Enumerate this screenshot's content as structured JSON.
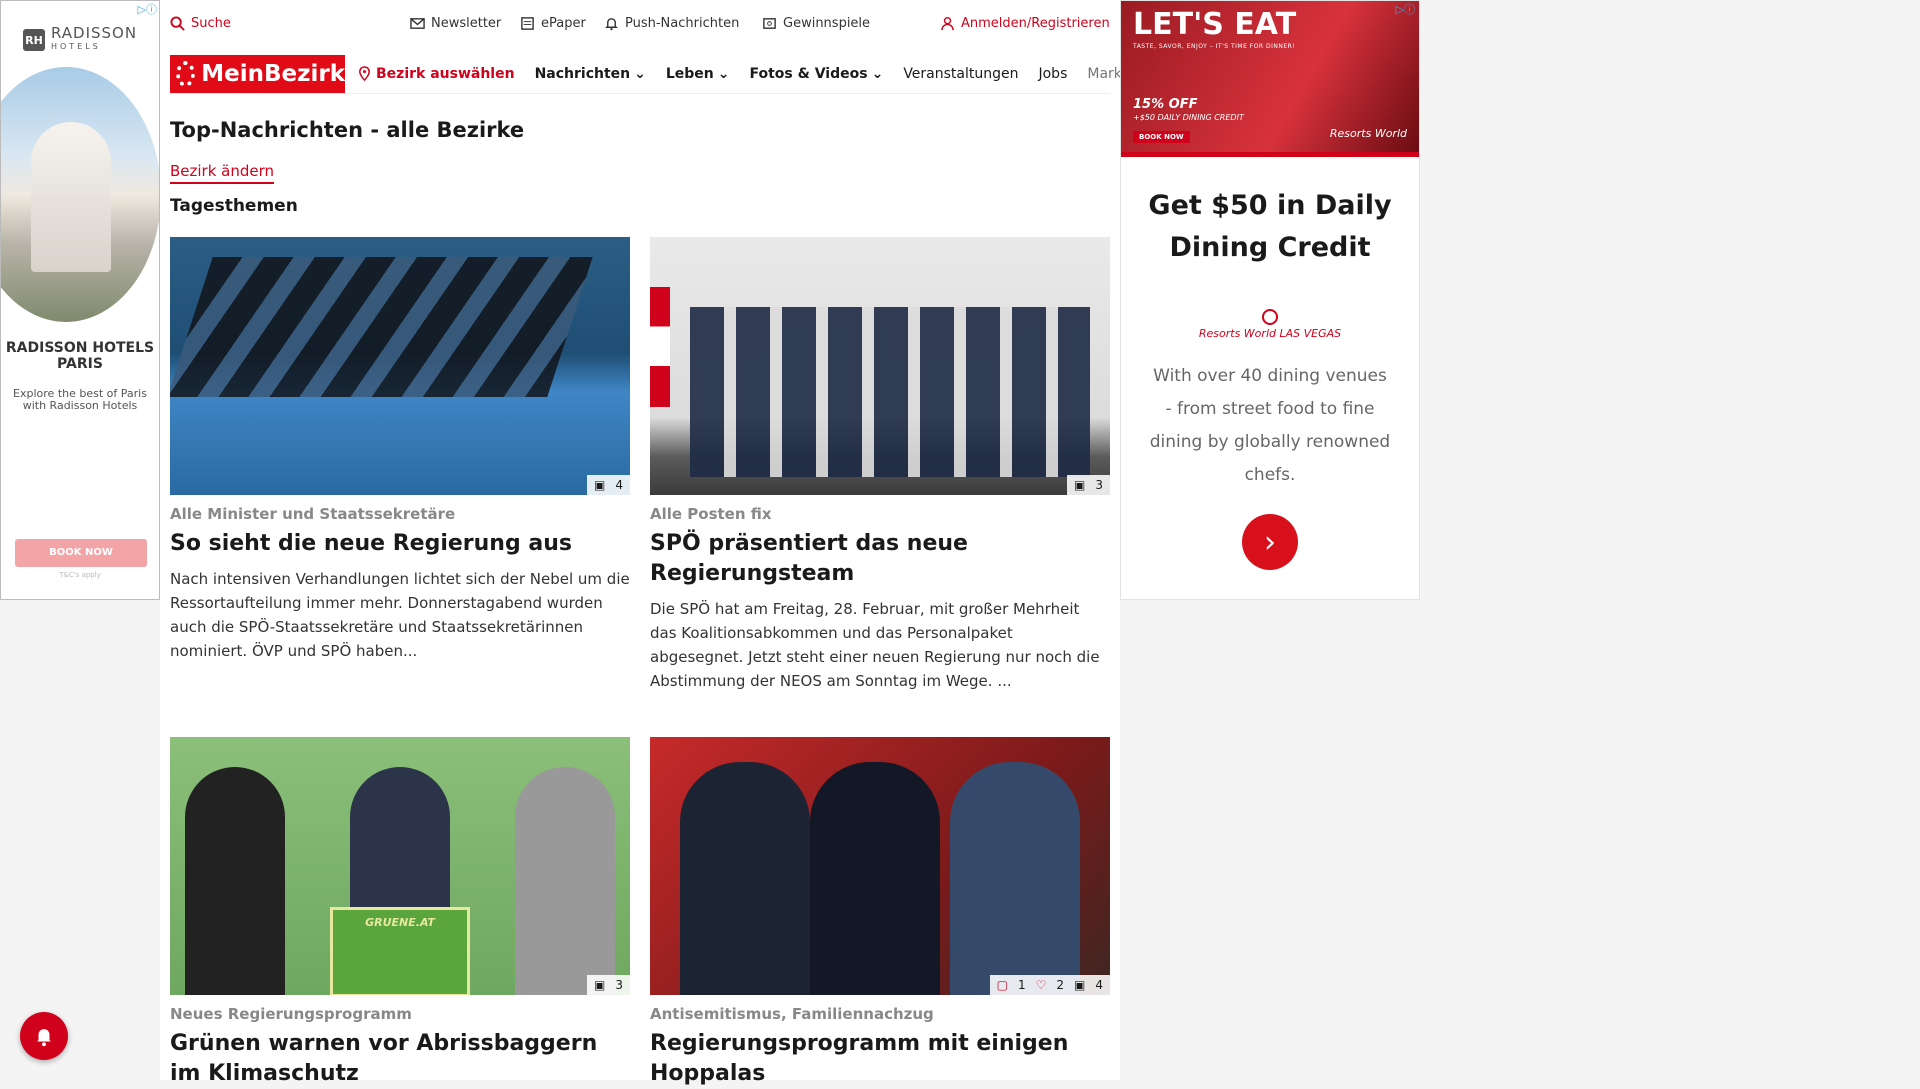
{
  "ad_left": {
    "adchoice": "▷ⓘ",
    "brand_mono": "RH",
    "brand_name": "RADISSON",
    "brand_sub": "HOTELS",
    "title": "RADISSON HOTELS PARIS",
    "description": "Explore the best of Paris with Radisson Hotels",
    "cta": "BOOK NOW",
    "tcs": "T&C's apply"
  },
  "topbar": {
    "search": "Suche",
    "newsletter": "Newsletter",
    "epaper": "ePaper",
    "push": "Push-Nachrichten",
    "gewinnspiele": "Gewinnspiele",
    "login": "Anmelden/Registrieren"
  },
  "nav": {
    "logo": "MeinBezirk",
    "bezirk": "Bezirk auswählen",
    "items": [
      "Nachrichten",
      "Leben",
      "Fotos & Videos",
      "Veranstaltungen",
      "Jobs",
      "Marktplatz"
    ]
  },
  "page": {
    "title": "Top-Nachrichten - alle Bezirke",
    "change_link": "Bezirk ändern",
    "section": "Tagesthemen"
  },
  "articles": [
    {
      "kicker": "Alle Minister und Staatssekretäre",
      "title": "So sieht die neue Regierung aus",
      "teaser": "Nach intensiven Verhandlungen lichtet sich der Nebel um die Ressortaufteilung immer mehr. Donnerstagabend wurden auch die SPÖ-Staatssekretäre und Staatssekretärinnen nominiert. ÖVP und SPÖ haben...",
      "photos": "4"
    },
    {
      "kicker": "Alle Posten fix",
      "title": "SPÖ präsentiert das neue Regierungsteam",
      "teaser": "Die SPÖ hat am Freitag, 28. Februar, mit großer Mehrheit das Koalitionsabkommen und das Personalpaket abgesegnet. Jetzt steht einer neuen Regierung nur noch die Abstimmung der NEOS am Sonntag im Wege. ...",
      "photos": "3"
    },
    {
      "kicker": "Neues Regierungsprogramm",
      "title": "Grünen warnen vor Abrissbaggern im Klimaschutz",
      "photos": "3",
      "podium_text": "GRUENE.AT"
    },
    {
      "kicker": "Antisemitismus, Familiennachzug",
      "title": "Regierungsprogramm mit einigen Hoppalas",
      "comments": "1",
      "likes": "2",
      "photos": "4"
    }
  ],
  "ad_right": {
    "adchoice": "▷ⓘ",
    "banner_headline": "LET'S EAT",
    "banner_tagline": "TASTE, SAVOR, ENJOY – IT'S TIME FOR DINNER!",
    "banner_offer": "15% OFF",
    "banner_sub": "+$50 DAILY DINING CREDIT",
    "banner_cta": "BOOK NOW",
    "banner_brand": "Resorts World",
    "headline": "Get $50 in Daily Dining Credit",
    "logo_text": "Resorts World LAS VEGAS",
    "copy": "With over 40 dining venues - from street food to fine dining by globally renowned chefs.",
    "go_symbol": "›"
  },
  "colors": {
    "brand_red": "#e10b17",
    "link_red": "#d0021b"
  }
}
